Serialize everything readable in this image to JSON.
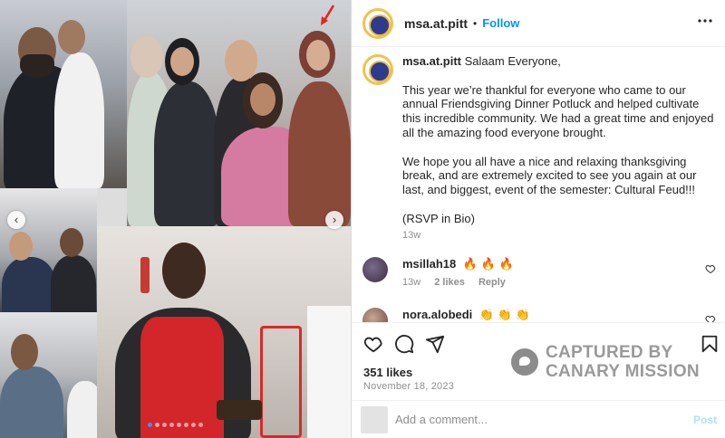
{
  "header": {
    "username": "msa.at.pitt",
    "separator": "•",
    "follow_label": "Follow",
    "more_icon": "more-horizontal-icon"
  },
  "caption": {
    "username": "msa.at.pitt",
    "greeting": "Salaam Everyone,",
    "paragraph1": "This year we’re thankful for everyone who came to our annual Friendsgiving Dinner Potluck and helped cultivate this incredible community. We had a great time and enjoyed all the amazing food everyone brought.",
    "paragraph2": "We hope you all have a nice and relaxing thanksgiving break, and are extremely excited to see you again at our last, and biggest, event of the semester: Cultural Feud!!!",
    "paragraph3": "(RSVP in Bio)",
    "time": "13w"
  },
  "comments": [
    {
      "username": "msillah18",
      "text": "🔥 🔥 🔥",
      "time": "13w",
      "likes": "2 likes",
      "reply": "Reply"
    },
    {
      "username": "nora.alobedi",
      "text": "👏 👏 👏"
    }
  ],
  "actions": {
    "likes": "351 likes",
    "date": "November 18, 2023"
  },
  "watermark": {
    "line1": "CAPTURED BY",
    "line2": "CANARY MISSION"
  },
  "add_comment": {
    "placeholder": "Add a comment...",
    "post_label": "Post"
  },
  "carousel": {
    "prev_icon": "‹",
    "next_icon": "›",
    "slide_count": 8,
    "active_index": 0
  },
  "colors": {
    "accent": "#0095f6",
    "text": "#262626",
    "muted": "#8e8e8e",
    "border": "#dbdbdb"
  }
}
